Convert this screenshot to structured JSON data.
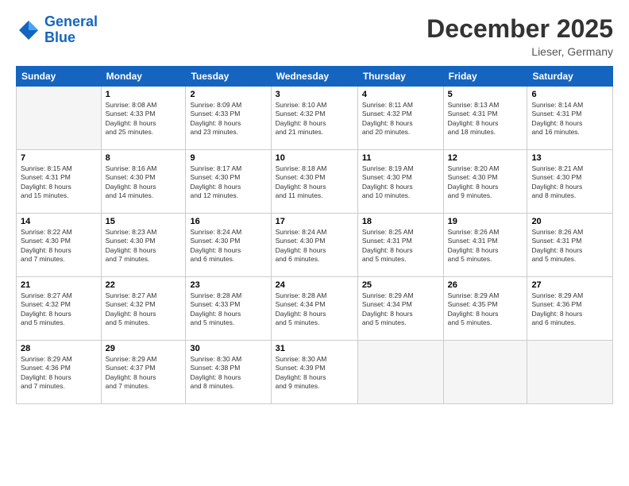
{
  "header": {
    "logo_line1": "General",
    "logo_line2": "Blue",
    "month_title": "December 2025",
    "location": "Lieser, Germany"
  },
  "weekdays": [
    "Sunday",
    "Monday",
    "Tuesday",
    "Wednesday",
    "Thursday",
    "Friday",
    "Saturday"
  ],
  "weeks": [
    [
      {
        "num": "",
        "info": ""
      },
      {
        "num": "1",
        "info": "Sunrise: 8:08 AM\nSunset: 4:33 PM\nDaylight: 8 hours\nand 25 minutes."
      },
      {
        "num": "2",
        "info": "Sunrise: 8:09 AM\nSunset: 4:33 PM\nDaylight: 8 hours\nand 23 minutes."
      },
      {
        "num": "3",
        "info": "Sunrise: 8:10 AM\nSunset: 4:32 PM\nDaylight: 8 hours\nand 21 minutes."
      },
      {
        "num": "4",
        "info": "Sunrise: 8:11 AM\nSunset: 4:32 PM\nDaylight: 8 hours\nand 20 minutes."
      },
      {
        "num": "5",
        "info": "Sunrise: 8:13 AM\nSunset: 4:31 PM\nDaylight: 8 hours\nand 18 minutes."
      },
      {
        "num": "6",
        "info": "Sunrise: 8:14 AM\nSunset: 4:31 PM\nDaylight: 8 hours\nand 16 minutes."
      }
    ],
    [
      {
        "num": "7",
        "info": "Sunrise: 8:15 AM\nSunset: 4:31 PM\nDaylight: 8 hours\nand 15 minutes."
      },
      {
        "num": "8",
        "info": "Sunrise: 8:16 AM\nSunset: 4:30 PM\nDaylight: 8 hours\nand 14 minutes."
      },
      {
        "num": "9",
        "info": "Sunrise: 8:17 AM\nSunset: 4:30 PM\nDaylight: 8 hours\nand 12 minutes."
      },
      {
        "num": "10",
        "info": "Sunrise: 8:18 AM\nSunset: 4:30 PM\nDaylight: 8 hours\nand 11 minutes."
      },
      {
        "num": "11",
        "info": "Sunrise: 8:19 AM\nSunset: 4:30 PM\nDaylight: 8 hours\nand 10 minutes."
      },
      {
        "num": "12",
        "info": "Sunrise: 8:20 AM\nSunset: 4:30 PM\nDaylight: 8 hours\nand 9 minutes."
      },
      {
        "num": "13",
        "info": "Sunrise: 8:21 AM\nSunset: 4:30 PM\nDaylight: 8 hours\nand 8 minutes."
      }
    ],
    [
      {
        "num": "14",
        "info": "Sunrise: 8:22 AM\nSunset: 4:30 PM\nDaylight: 8 hours\nand 7 minutes."
      },
      {
        "num": "15",
        "info": "Sunrise: 8:23 AM\nSunset: 4:30 PM\nDaylight: 8 hours\nand 7 minutes."
      },
      {
        "num": "16",
        "info": "Sunrise: 8:24 AM\nSunset: 4:30 PM\nDaylight: 8 hours\nand 6 minutes."
      },
      {
        "num": "17",
        "info": "Sunrise: 8:24 AM\nSunset: 4:30 PM\nDaylight: 8 hours\nand 6 minutes."
      },
      {
        "num": "18",
        "info": "Sunrise: 8:25 AM\nSunset: 4:31 PM\nDaylight: 8 hours\nand 5 minutes."
      },
      {
        "num": "19",
        "info": "Sunrise: 8:26 AM\nSunset: 4:31 PM\nDaylight: 8 hours\nand 5 minutes."
      },
      {
        "num": "20",
        "info": "Sunrise: 8:26 AM\nSunset: 4:31 PM\nDaylight: 8 hours\nand 5 minutes."
      }
    ],
    [
      {
        "num": "21",
        "info": "Sunrise: 8:27 AM\nSunset: 4:32 PM\nDaylight: 8 hours\nand 5 minutes."
      },
      {
        "num": "22",
        "info": "Sunrise: 8:27 AM\nSunset: 4:32 PM\nDaylight: 8 hours\nand 5 minutes."
      },
      {
        "num": "23",
        "info": "Sunrise: 8:28 AM\nSunset: 4:33 PM\nDaylight: 8 hours\nand 5 minutes."
      },
      {
        "num": "24",
        "info": "Sunrise: 8:28 AM\nSunset: 4:34 PM\nDaylight: 8 hours\nand 5 minutes."
      },
      {
        "num": "25",
        "info": "Sunrise: 8:29 AM\nSunset: 4:34 PM\nDaylight: 8 hours\nand 5 minutes."
      },
      {
        "num": "26",
        "info": "Sunrise: 8:29 AM\nSunset: 4:35 PM\nDaylight: 8 hours\nand 5 minutes."
      },
      {
        "num": "27",
        "info": "Sunrise: 8:29 AM\nSunset: 4:36 PM\nDaylight: 8 hours\nand 6 minutes."
      }
    ],
    [
      {
        "num": "28",
        "info": "Sunrise: 8:29 AM\nSunset: 4:36 PM\nDaylight: 8 hours\nand 7 minutes."
      },
      {
        "num": "29",
        "info": "Sunrise: 8:29 AM\nSunset: 4:37 PM\nDaylight: 8 hours\nand 7 minutes."
      },
      {
        "num": "30",
        "info": "Sunrise: 8:30 AM\nSunset: 4:38 PM\nDaylight: 8 hours\nand 8 minutes."
      },
      {
        "num": "31",
        "info": "Sunrise: 8:30 AM\nSunset: 4:39 PM\nDaylight: 8 hours\nand 9 minutes."
      },
      {
        "num": "",
        "info": ""
      },
      {
        "num": "",
        "info": ""
      },
      {
        "num": "",
        "info": ""
      }
    ]
  ]
}
